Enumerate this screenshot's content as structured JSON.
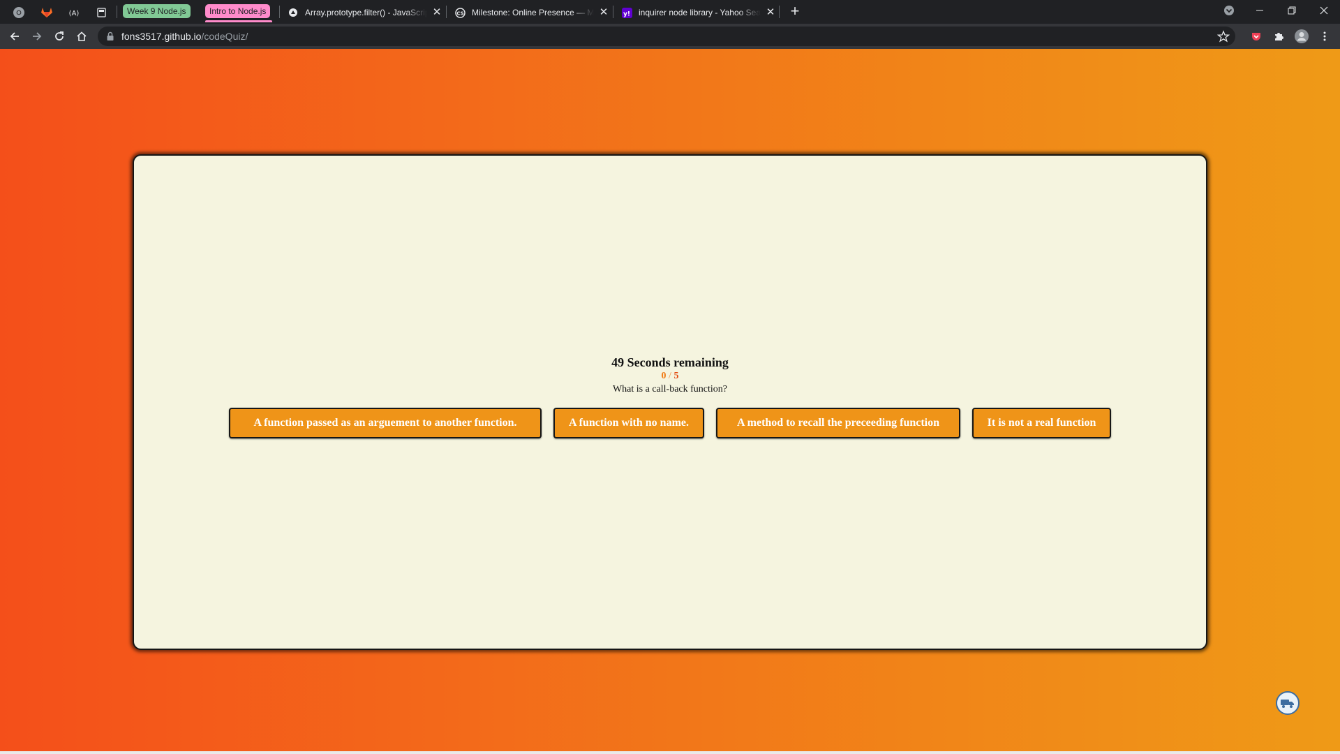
{
  "browser": {
    "tab_groups": [
      {
        "label": "Week 9 Node.js",
        "color": "#81c995",
        "text_color": "#202124"
      },
      {
        "label": "Intro to Node.js",
        "color": "#ff8bcb",
        "text_color": "#202124"
      }
    ],
    "tabs": [
      {
        "title": "Array.prototype.filter() - JavaScript | MDN",
        "icon": "mdn-icon"
      },
      {
        "title": "Milestone: Online Presence — Module",
        "icon": "codesignal-icon"
      },
      {
        "title": "inquirer node library - Yahoo Search",
        "icon": "yahoo-icon"
      }
    ],
    "close_glyph": "✕",
    "new_tab_glyph": "+",
    "url_host": "fons3517.github.io",
    "url_path": "/codeQuiz/"
  },
  "quiz": {
    "timer_text": "49 Seconds remaining",
    "score": "0",
    "separator": " / ",
    "total": "5",
    "question": "What is a call-back function?",
    "answers": [
      "A function passed as an arguement to another function.",
      "A function with no name.",
      "A method to recall the preceeding function",
      "It is not a real function"
    ]
  },
  "colors": {
    "page_gradient_start": "#f44f1a",
    "page_gradient_end": "#ef9a17",
    "card_bg": "#f5f4df",
    "button_bg": "#ef9418",
    "score_color": "#f07c17",
    "total_color": "#e24a10"
  }
}
